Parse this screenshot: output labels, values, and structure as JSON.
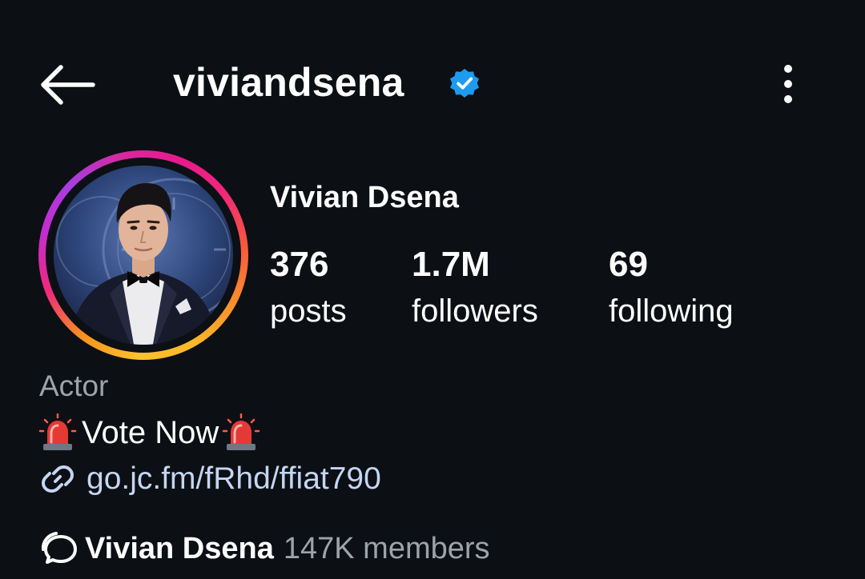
{
  "header": {
    "username": "viviandsena",
    "verified": true,
    "back_icon": "arrow-left-icon",
    "menu_icon": "more-vertical-icon"
  },
  "profile": {
    "full_name": "Vivian Dsena",
    "avatar_icon": "profile-photo",
    "story_ring_colors": [
      "#e61a8d",
      "#f75a3c",
      "#fbc02d",
      "#c72bd0"
    ],
    "stats": [
      {
        "value": "376",
        "label": "posts"
      },
      {
        "value": "1.7M",
        "label": "followers"
      },
      {
        "value": "69",
        "label": "following"
      }
    ],
    "category": "Actor",
    "bio": {
      "leading_emoji": "🚨",
      "text": "Vote Now",
      "trailing_emoji": "🚨"
    },
    "link": {
      "icon": "link-icon",
      "text": "go.jc.fm/fRhd/ffiat790"
    },
    "channel": {
      "icon": "broadcast-channel-icon",
      "name": "Vivian Dsena",
      "members": "147K members"
    }
  },
  "colors": {
    "background": "#0c0f14",
    "verified_badge": "#1d9bf0",
    "link": "#c4d6f3",
    "secondary_text": "#9ea3ab"
  }
}
